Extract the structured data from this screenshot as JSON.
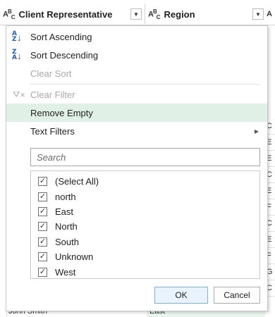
{
  "header": {
    "col1": {
      "type_icon": "ABC",
      "title": "Client Representative"
    },
    "col2": {
      "type_icon": "ABC",
      "title": "Region"
    },
    "col3": {
      "type_icon": "A"
    }
  },
  "menu": {
    "sort_ascending": "Sort Ascending",
    "sort_descending": "Sort Descending",
    "clear_sort": "Clear Sort",
    "clear_filter": "Clear Filter",
    "remove_empty": "Remove Empty",
    "text_filters": "Text Filters"
  },
  "search": {
    "placeholder": "Search"
  },
  "values": [
    {
      "label": "(Select All)",
      "checked": true
    },
    {
      "label": "north",
      "checked": true
    },
    {
      "label": "East",
      "checked": true
    },
    {
      "label": "North",
      "checked": true
    },
    {
      "label": "South",
      "checked": true
    },
    {
      "label": "Unknown",
      "checked": true
    },
    {
      "label": "West",
      "checked": true
    }
  ],
  "buttons": {
    "ok": "OK",
    "cancel": "Cancel"
  },
  "right_column_cells": [
    "C",
    "E",
    "E",
    "C",
    "E",
    "F",
    "C",
    "E",
    "F",
    "G",
    "C"
  ],
  "bottom_row": {
    "left": "John Smith",
    "right": "East"
  },
  "colors": {
    "highlight": "#e1f0e6",
    "accent_green": "#2e8b57",
    "sort_letters": "#1f5fbf"
  }
}
